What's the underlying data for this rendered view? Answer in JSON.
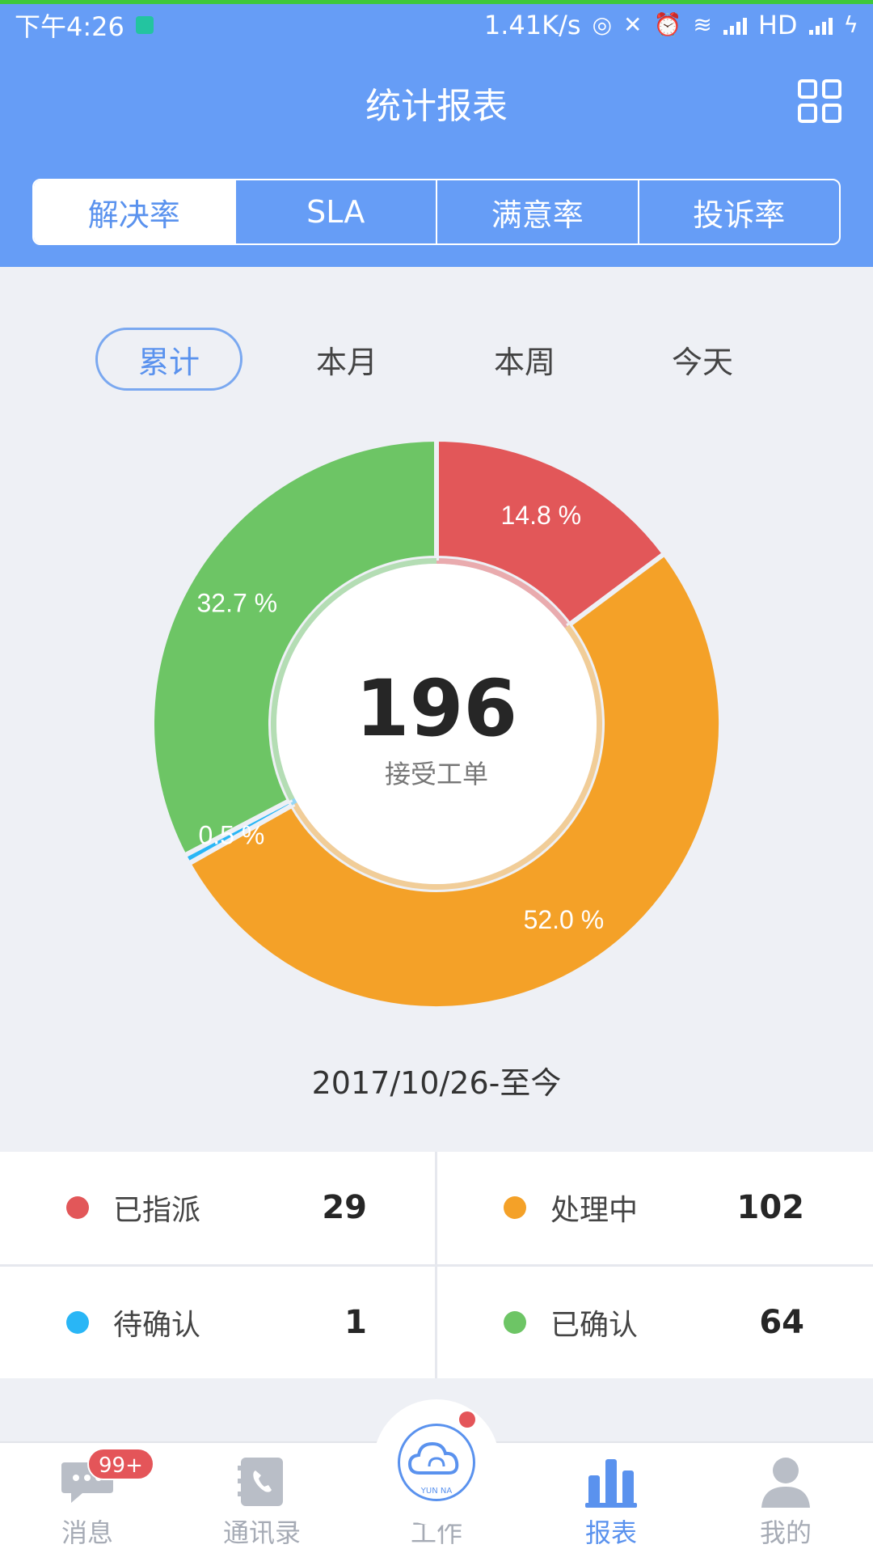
{
  "status_bar": {
    "time": "下午4:26",
    "speed": "1.41K/s",
    "network": "HD"
  },
  "header": {
    "title": "统计报表",
    "tabs": [
      {
        "label": "解决率",
        "active": true
      },
      {
        "label": "SLA",
        "active": false
      },
      {
        "label": "满意率",
        "active": false
      },
      {
        "label": "投诉率",
        "active": false
      }
    ]
  },
  "period": {
    "items": [
      {
        "label": "累计",
        "active": true
      },
      {
        "label": "本月",
        "active": false
      },
      {
        "label": "本周",
        "active": false
      },
      {
        "label": "今天",
        "active": false
      }
    ]
  },
  "chart_data": {
    "type": "pie",
    "center_total": "196",
    "center_label": "接受工单",
    "slices": [
      {
        "name": "已指派",
        "value": 29,
        "percent_label": "14.8 %",
        "color": "#e25759"
      },
      {
        "name": "处理中",
        "value": 102,
        "percent_label": "52.0 %",
        "color": "#f4a128"
      },
      {
        "name": "待确认",
        "value": 1,
        "percent_label": "0.5 %",
        "color": "#29b6f6"
      },
      {
        "name": "已确认",
        "value": 64,
        "percent_label": "32.7 %",
        "color": "#6dc565"
      }
    ]
  },
  "date_range": "2017/10/26-至今",
  "legend": [
    {
      "name": "已指派",
      "value": "29",
      "color": "#e25759"
    },
    {
      "name": "处理中",
      "value": "102",
      "color": "#f4a128"
    },
    {
      "name": "待确认",
      "value": "1",
      "color": "#29b6f6"
    },
    {
      "name": "已确认",
      "value": "64",
      "color": "#6dc565"
    }
  ],
  "tabbar": {
    "items": [
      {
        "label": "消息",
        "icon": "chat-bubble-icon",
        "badge": "99+",
        "active": false
      },
      {
        "label": "通讯录",
        "icon": "phone-book-icon",
        "active": false
      },
      {
        "label": "工作",
        "icon": "cloud-logo-icon",
        "logo_text": "YUN NA",
        "active": false
      },
      {
        "label": "报表",
        "icon": "bar-chart-icon",
        "active": true
      },
      {
        "label": "我的",
        "icon": "person-icon",
        "active": false
      }
    ]
  },
  "colors": {
    "primary": "#669df6",
    "accent_text": "#5a92ee",
    "background": "#eef0f5"
  }
}
